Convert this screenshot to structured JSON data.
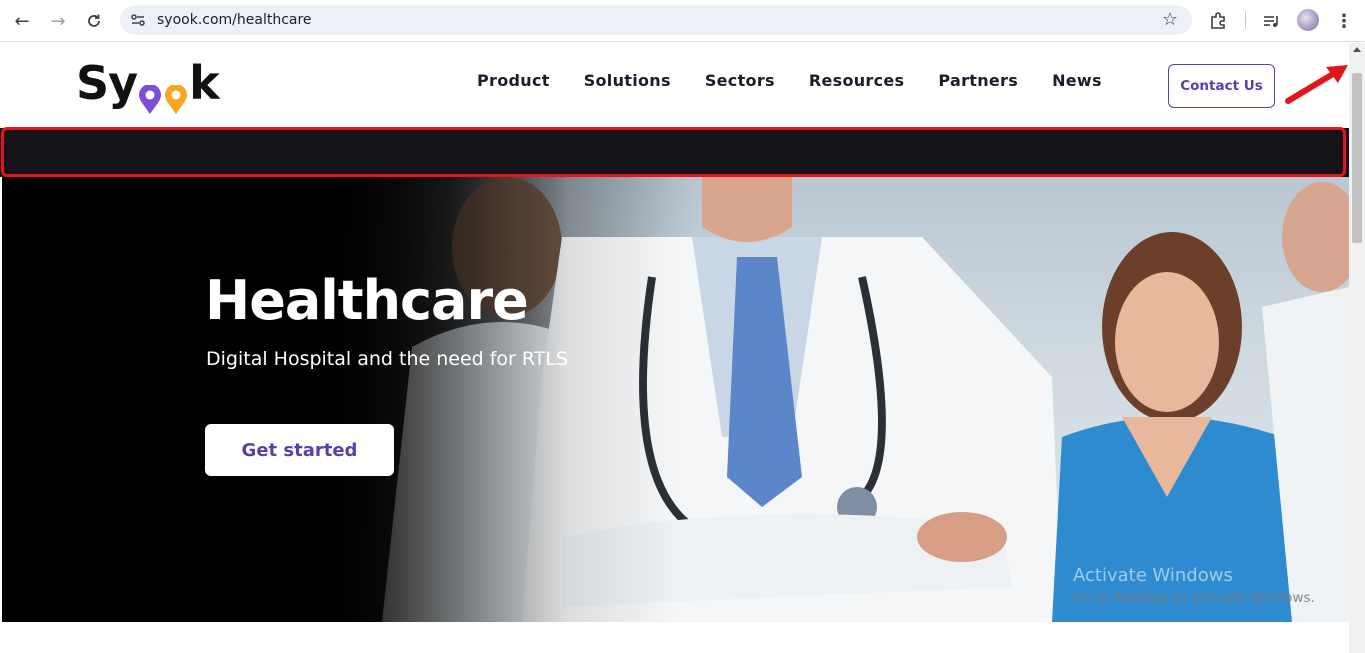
{
  "browser": {
    "url": "syook.com/healthcare",
    "back_icon": "arrow-left-icon",
    "forward_icon": "arrow-right-icon",
    "reload_icon": "reload-icon"
  },
  "site": {
    "logo_text": "Sy",
    "logo_text_end": "k",
    "menu": [
      "Product",
      "Solutions",
      "Sectors",
      "Resources",
      "Partners",
      "News"
    ],
    "contact_label": "Contact Us",
    "accent_color": "#5b3fa8",
    "brand_pin_colors": [
      "#7b4fd6",
      "#f5a623"
    ]
  },
  "hero": {
    "title": "Healthcare",
    "subtitle": "Digital Hospital and the need for RTLS",
    "cta_label": "Get started"
  },
  "annotation": {
    "highlight_color": "#e4141b"
  },
  "watermark": {
    "line1": "Activate Windows",
    "line2": "Go to Settings to activate Windows."
  }
}
